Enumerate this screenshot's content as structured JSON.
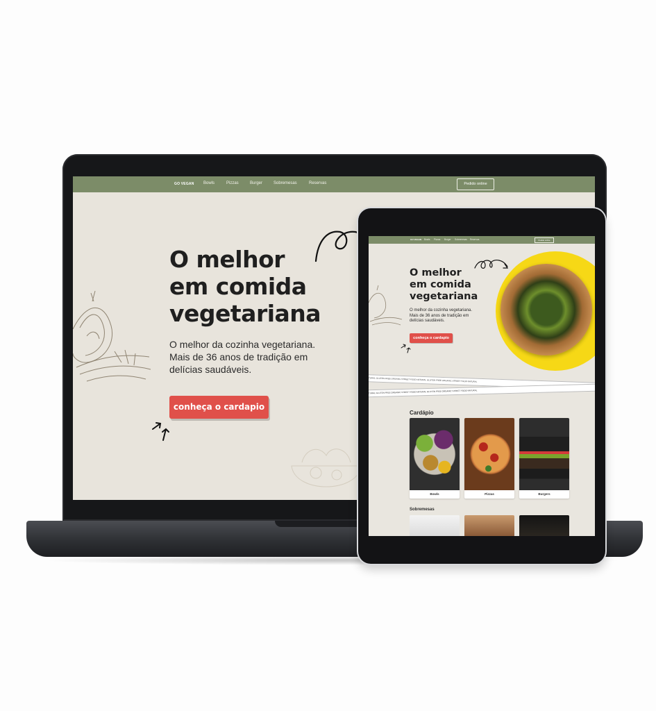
{
  "laptop": {
    "nav": {
      "logo": "GO VEGAN",
      "links": [
        "Bowls",
        "Pizzas",
        "Burger",
        "Sobremesas",
        "Reservas"
      ],
      "cta": "Pedido online"
    },
    "hero": {
      "title_lines": [
        "O melhor",
        "em comida",
        "vegetariana"
      ],
      "subtitle_lines": [
        "O melhor da cozinha vegetariana.",
        "Mais de 36 anos de tradição em",
        "delícias saudáveis."
      ],
      "button": "conheça o cardapio"
    }
  },
  "tablet": {
    "nav": {
      "logo": "GO VEGAN",
      "links": [
        "Bowls",
        "Pizzas",
        "Burger",
        "Sobremesas",
        "Reservas"
      ],
      "cta": "Pedido online"
    },
    "hero": {
      "title_lines": [
        "O melhor",
        "em comida",
        "vegetariana"
      ],
      "subtitle_lines": [
        "O melhor da cozinha vegetariana.",
        "Mais de 36 anos de tradição em",
        "delícias saudáveis."
      ],
      "button": "conheça o cardapio"
    },
    "ribbon_top": "NATURAL   GLUTEN FREE   ORGANIC   STREET FOOD   NATURAL   GLUTEN FREE   ORGANIC   STREET FOOD   NATURAL",
    "ribbon_bottom": "NATURAL   GLUTEN FREE   ORGANIC   STREET FOOD   NATURAL   GLUTEN FREE   ORGANIC   STREET FOOD   NATURAL",
    "menu_title": "Cardápio",
    "menu_items": [
      "Bowls",
      "Pizzas",
      "Burgers"
    ],
    "desserts_title": "Sobremesas"
  },
  "colors": {
    "nav_green": "#7c8c68",
    "background": "#e8e4dc",
    "cta_red": "#e0504a",
    "accent_yellow": "#f6d816"
  }
}
